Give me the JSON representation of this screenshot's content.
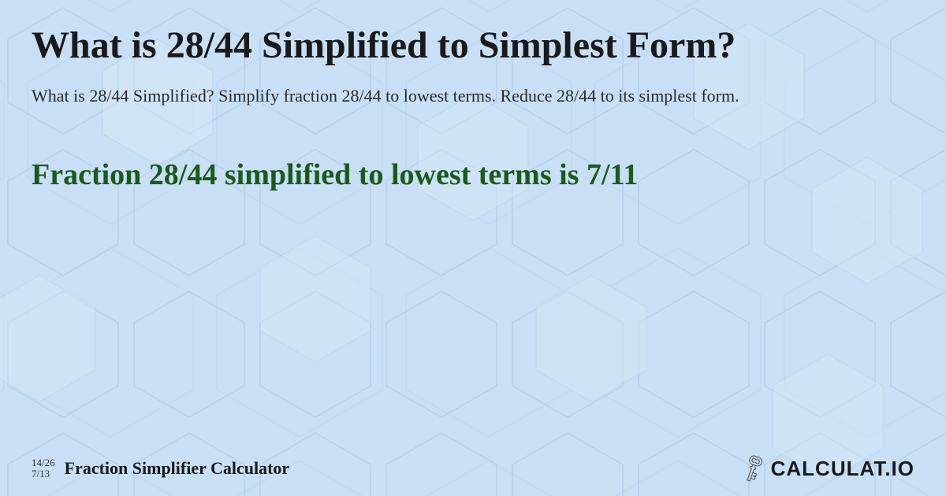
{
  "page": {
    "title": "What is 28/44 Simplified to Simplest Form?",
    "description": "What is 28/44 Simplified? Simplify fraction 28/44 to lowest terms. Reduce 28/44 to its simplest form.",
    "result_title": "Fraction 28/44 simplified to lowest terms is 7/11",
    "background_color": "#c8dff5"
  },
  "footer": {
    "fraction1": "14/26",
    "fraction2": "7/13",
    "label": "Fraction Simplifier Calculator",
    "logo_text": "CALCULAT.IO"
  }
}
